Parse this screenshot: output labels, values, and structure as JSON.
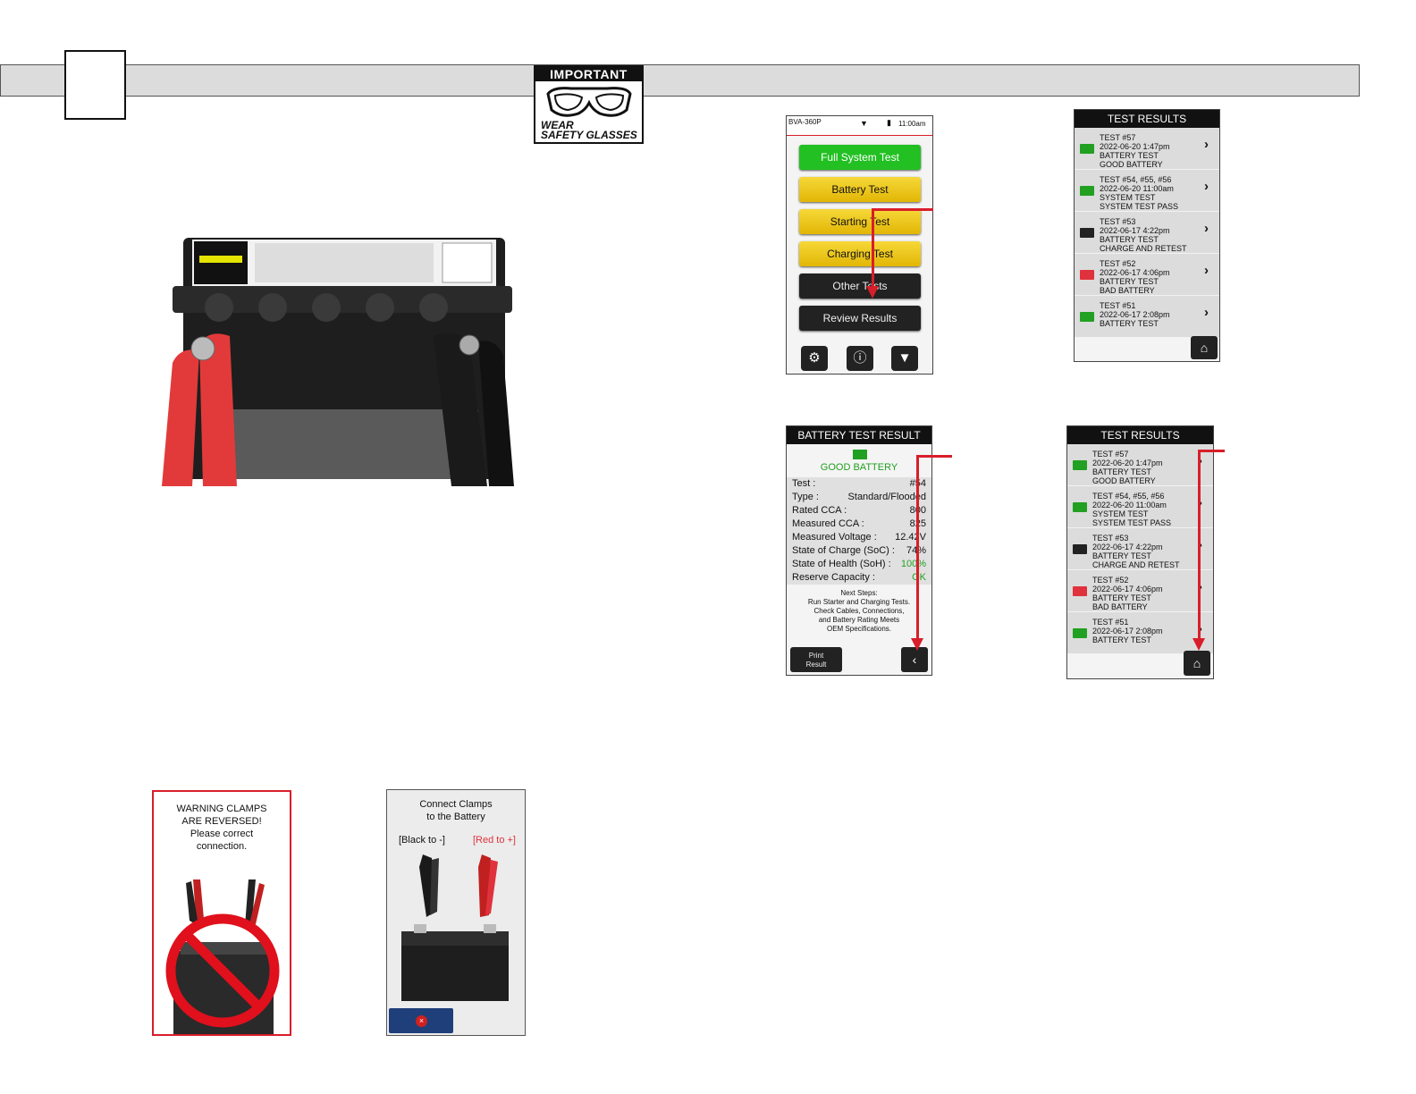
{
  "important_label": {
    "top": "IMPORTANT",
    "line1": "WEAR",
    "line2": "SAFETY GLASSES"
  },
  "main_menu": {
    "model": "BVA-360P",
    "time": "11:00am",
    "buttons": [
      "Full System Test",
      "Battery Test",
      "Starting Test",
      "Charging Test",
      "Other Tests",
      "Review Results"
    ],
    "icons": [
      "gear-icon",
      "info-icon",
      "flashlight-icon"
    ]
  },
  "results_list": {
    "title": "TEST RESULTS",
    "items": [
      {
        "l1": "TEST #57",
        "l2": "2022-06-20  1:47pm",
        "l3": "BATTERY TEST",
        "l4": "GOOD BATTERY",
        "color": "#22a022"
      },
      {
        "l1": "TEST #54, #55, #56",
        "l2": "2022-06-20 11:00am",
        "l3": "SYSTEM TEST",
        "l4": "SYSTEM TEST PASS",
        "color": "#22a022"
      },
      {
        "l1": "TEST #53",
        "l2": "2022-06-17  4:22pm",
        "l3": "BATTERY TEST",
        "l4": "CHARGE AND RETEST",
        "color": "#222222"
      },
      {
        "l1": "TEST #52",
        "l2": "2022-06-17  4:06pm",
        "l3": "BATTERY TEST",
        "l4": "BAD BATTERY",
        "color": "#e0323c"
      },
      {
        "l1": "TEST #51",
        "l2": "2022-06-17  2:08pm",
        "l3": "BATTERY TEST",
        "l4": "",
        "color": "#22a022"
      }
    ]
  },
  "battery_result": {
    "title": "BATTERY TEST RESULT",
    "status": "GOOD BATTERY",
    "rows": [
      {
        "k": "Test :",
        "v": "#54"
      },
      {
        "k": "Type :",
        "v": "Standard/Flooded"
      },
      {
        "k": "Rated CCA :",
        "v": "800"
      },
      {
        "k": "Measured CCA :",
        "v": "825"
      },
      {
        "k": "Measured Voltage :",
        "v": "12.42V"
      },
      {
        "k": "State of Charge (SoC) :",
        "v": "74%"
      },
      {
        "k": "State of Health (SoH) :",
        "v": "100%"
      },
      {
        "k": "Reserve Capacity  :",
        "v": "OK"
      }
    ],
    "next_steps": [
      "Next Steps:",
      "Run Starter and Charging Tests.",
      "Check Cables, Connections,",
      "and Battery Rating Meets",
      "OEM Specifications."
    ],
    "print_label_1": "Print",
    "print_label_2": "Result"
  },
  "warning_screen": {
    "lines": [
      "WARNING CLAMPS",
      "ARE REVERSED!",
      "Please correct",
      "connection."
    ]
  },
  "connect_screen": {
    "title_1": "Connect Clamps",
    "title_2": "to the Battery",
    "black_label": "[Black to -]",
    "red_label": "[Red to +]"
  }
}
